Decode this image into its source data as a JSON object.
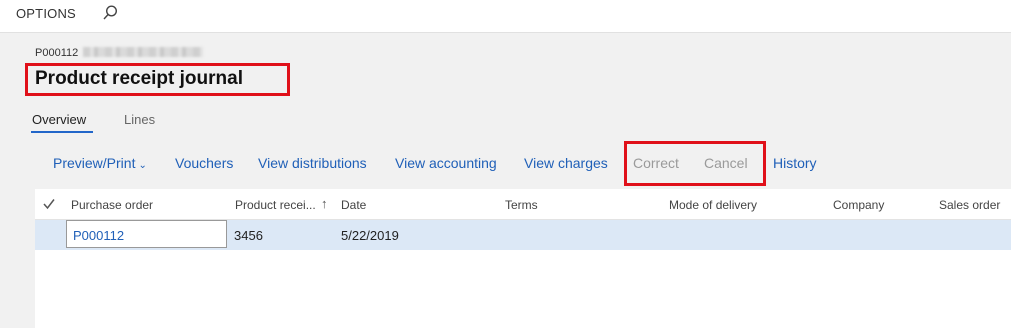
{
  "topbar": {
    "options_label": "OPTIONS",
    "search_icon": "search-icon"
  },
  "header": {
    "record_id": "P000112",
    "title": "Product receipt journal"
  },
  "tabs": [
    {
      "label": "Overview",
      "selected": true
    },
    {
      "label": "Lines",
      "selected": false
    }
  ],
  "actions": [
    {
      "label": "Preview/Print",
      "has_dropdown": true,
      "enabled": true
    },
    {
      "label": "Vouchers",
      "enabled": true
    },
    {
      "label": "View distributions",
      "enabled": true
    },
    {
      "label": "View accounting",
      "enabled": true
    },
    {
      "label": "View charges",
      "enabled": true
    },
    {
      "label": "Correct",
      "enabled": false
    },
    {
      "label": "Cancel",
      "enabled": false
    },
    {
      "label": "History",
      "enabled": true
    }
  ],
  "grid": {
    "columns": [
      "Purchase order",
      "Product recei...",
      "Date",
      "Terms",
      "Mode of delivery",
      "Company",
      "Sales order"
    ],
    "rows": [
      {
        "purchase_order": "P000112",
        "product_receipt": "3456",
        "date": "5/22/2019"
      }
    ]
  },
  "colors": {
    "link": "#2060b8",
    "disabled": "#9a9a9a",
    "highlight_box": "#e0101a",
    "selected_row": "#dce8f6"
  }
}
